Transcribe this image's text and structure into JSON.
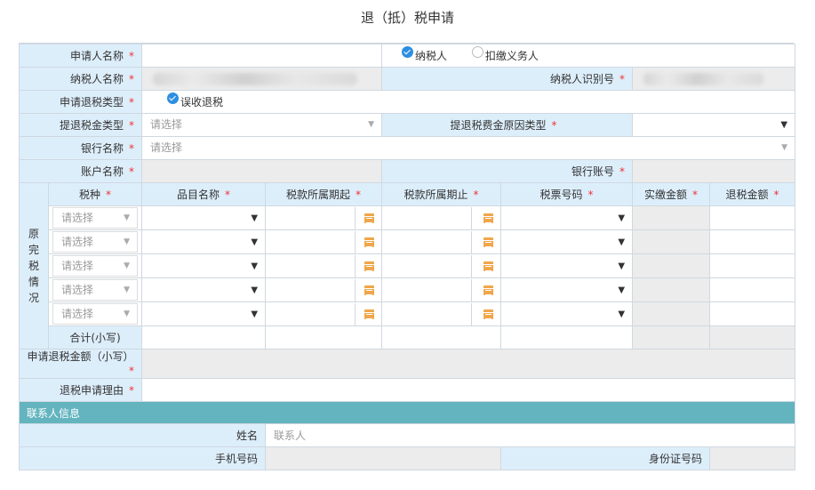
{
  "page_title": "退（抵）税申请",
  "fields": {
    "applicant_name": {
      "label": "申请人名称",
      "required": "*"
    },
    "applicant_type_options": [
      {
        "label": "纳税人",
        "checked": true
      },
      {
        "label": "扣缴义务人",
        "checked": false
      }
    ],
    "taxpayer_name": {
      "label": "纳税人名称",
      "required": "*"
    },
    "taxpayer_id": {
      "label": "纳税人识别号",
      "required": "*"
    },
    "refund_type": {
      "label": "申请退税类型",
      "required": "*",
      "option": "误收退税",
      "checked": true
    },
    "refund_amount_type": {
      "label": "提退税金类型",
      "required": "*",
      "placeholder": "请选择"
    },
    "refund_reason_type": {
      "label": "提退税费金原因类型",
      "required": "*"
    },
    "bank_name": {
      "label": "银行名称",
      "required": "*",
      "placeholder": "请选择"
    },
    "account_name": {
      "label": "账户名称",
      "required": "*"
    },
    "bank_account": {
      "label": "银行账号",
      "required": "*"
    }
  },
  "original_tax": {
    "side_label": [
      "原",
      "完",
      "税",
      "情",
      "况"
    ],
    "headers": [
      {
        "label": "税种",
        "required": "*"
      },
      {
        "label": "品目名称",
        "required": "*"
      },
      {
        "label": "税款所属期起",
        "required": "*"
      },
      {
        "label": "税款所属期止",
        "required": "*"
      },
      {
        "label": "税票号码",
        "required": "*"
      },
      {
        "label": "实缴金额",
        "required": "*"
      },
      {
        "label": "退税金额",
        "required": "*"
      }
    ],
    "row_placeholder": "请选择",
    "rows": 5,
    "total_label": "合计(小写)"
  },
  "apply_refund_amount": {
    "label": "申请退税金额（小写）",
    "required": "*"
  },
  "refund_reason": {
    "label": "退税申请理由",
    "required": "*"
  },
  "contact_section": {
    "title": "联系人信息",
    "name_label": "姓名",
    "name_placeholder": "联系人",
    "phone_label": "手机号码",
    "id_label": "身份证号码"
  },
  "colors": {
    "label_bg": "#ddeefb",
    "section_bg": "#63b4bf",
    "required": "#e33333",
    "calendar": "#f0a64a",
    "readonly_bg": "#ececec"
  }
}
